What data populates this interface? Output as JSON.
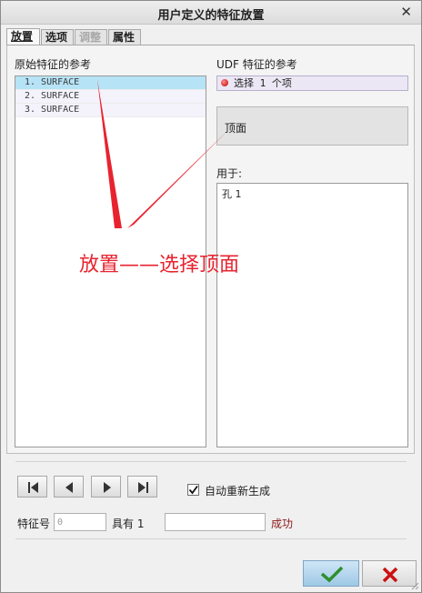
{
  "window": {
    "title": "用户定义的特征放置",
    "close_icon": "close-icon"
  },
  "tabs": [
    {
      "label": "放置",
      "state": "active"
    },
    {
      "label": "选项",
      "state": "normal"
    },
    {
      "label": "调整",
      "state": "disabled"
    },
    {
      "label": "属性",
      "state": "normal"
    }
  ],
  "left": {
    "heading": "原始特征的参考",
    "items": [
      {
        "label": "1. SURFACE",
        "selected": true
      },
      {
        "label": "2. SURFACE",
        "selected": false
      },
      {
        "label": "3. SURFACE",
        "selected": false
      }
    ]
  },
  "right": {
    "heading": "UDF 特征的参考",
    "select_status": "选择 1 个项",
    "reference_value": "顶面",
    "used_for_label": "用于:",
    "used_for_items": [
      "孔 1"
    ]
  },
  "annotation": {
    "text": "放置——选择顶面",
    "color": "#e8232f"
  },
  "controls": {
    "nav_icons": [
      "first-icon",
      "previous-icon",
      "next-icon",
      "last-icon"
    ],
    "auto_regenerate_label": "自动重新生成",
    "auto_regenerate_checked": true,
    "feature_no_label": "特征号",
    "feature_no_value": "0",
    "has_label": "具有 1",
    "has_value": "",
    "status_text": "成功",
    "status_color": "#8b1a1a"
  },
  "footer": {
    "ok_icon": "check-icon",
    "cancel_icon": "cancel-x-icon"
  },
  "colors": {
    "selection": "#b6e3f6",
    "ok_button": "#9ec8e6",
    "cancel_x": "#cc1111"
  }
}
